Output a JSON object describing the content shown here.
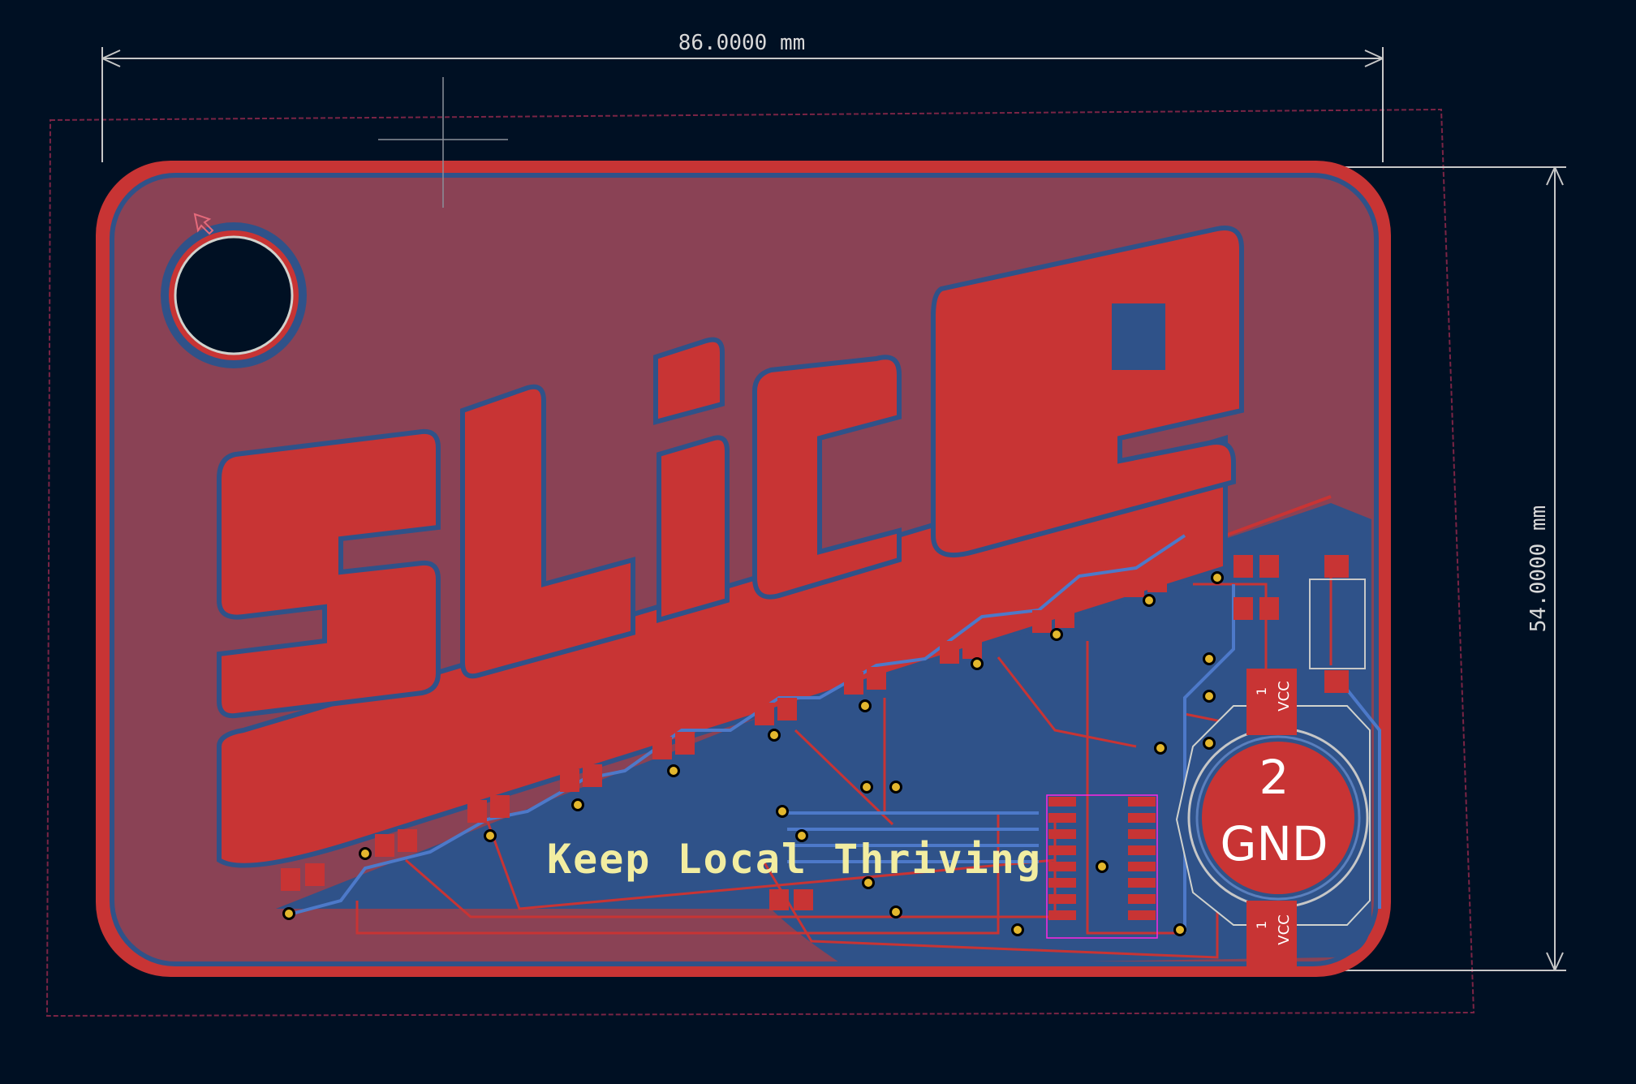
{
  "dimensions": {
    "width_label": "86.0000 mm",
    "height_label": "54.0000 mm"
  },
  "board": {
    "logo_text": "SLiCE",
    "silkscreen_text": "Keep Local Thriving"
  },
  "battery": {
    "pin2_number": "2",
    "pin2_name": "GND",
    "pin1_top_number": "1",
    "pin1_top_name": "VCC",
    "pin1_bottom_number": "1",
    "pin1_bottom_name": "VCC"
  },
  "colors": {
    "background": "#001023",
    "board_fill": "#8a4255",
    "copper_front": "#c83434",
    "copper_back": "#2f5289",
    "outline": "#d0d2cd",
    "silkscreen": "#f2eda1",
    "via": "#e3b72e",
    "courtyard": "#ff26e2"
  },
  "icons": [
    "cursor-arrow-icon",
    "crosshair-icon"
  ]
}
